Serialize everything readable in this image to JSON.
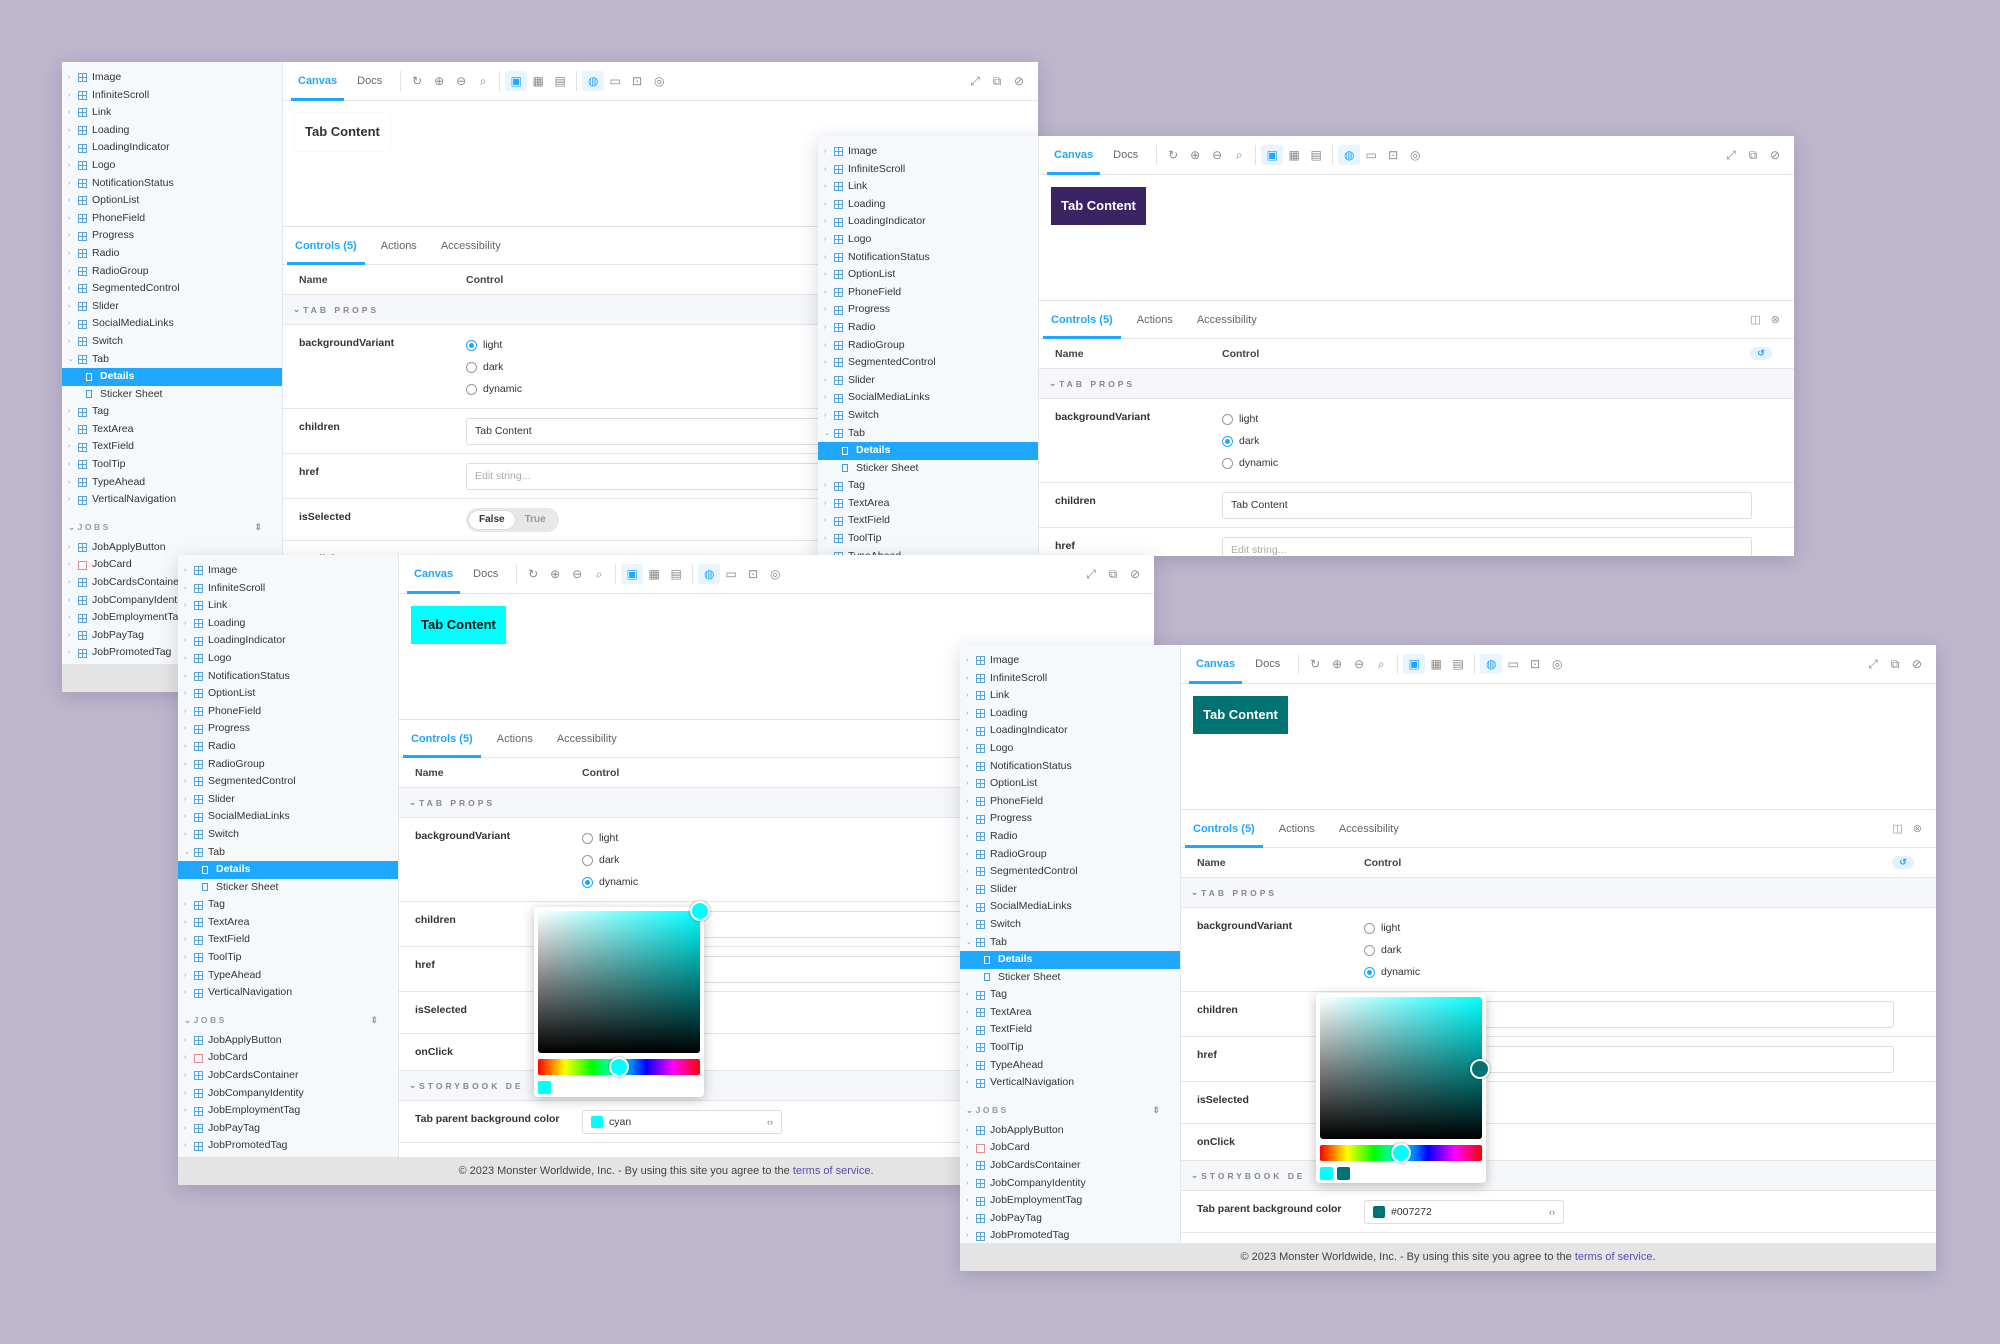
{
  "tree_items": [
    "Image",
    "InfiniteScroll",
    "Link",
    "Loading",
    "LoadingIndicator",
    "Logo",
    "NotificationStatus",
    "OptionList",
    "PhoneField",
    "Progress",
    "Radio",
    "RadioGroup",
    "SegmentedControl",
    "Slider",
    "SocialMediaLinks",
    "Switch",
    "Tab"
  ],
  "tab_stories": [
    "Details",
    "Sticker Sheet"
  ],
  "tree_items_after": [
    "Tag",
    "TextArea",
    "TextField",
    "ToolTip",
    "TypeAhead",
    "VerticalNavigation"
  ],
  "jobs_section": "JOBS",
  "jobs_items": [
    "JobApplyButton",
    "JobCard",
    "JobCardsContainer",
    "JobCompanyIdentity",
    "JobEmploymentTag",
    "JobPayTag",
    "JobPromotedTag"
  ],
  "toolbar": {
    "canvas": "Canvas",
    "docs": "Docs"
  },
  "panel_tabs": {
    "controls": "Controls (5)",
    "actions": "Actions",
    "accessibility": "Accessibility"
  },
  "table": {
    "name_header": "Name",
    "control_header": "Control",
    "group": "TAB PROPS",
    "storybook_group": "STORYBOOK DE"
  },
  "props": {
    "backgroundVariant": "backgroundVariant",
    "options": [
      "light",
      "dark",
      "dynamic"
    ],
    "children": "children",
    "children_value": "Tab Content",
    "href": "href",
    "href_placeholder": "Edit string...",
    "isSelected": "isSelected",
    "false_label": "False",
    "true_label": "True",
    "onClick": "onClick",
    "onClick_value": "-",
    "parent_bg": "Tab parent background color"
  },
  "tab_content": "Tab Content",
  "windows": [
    {
      "selected_variant": "light",
      "tab_bg": "#ffffff",
      "tab_fg": "#333333"
    },
    {
      "selected_variant": "dark",
      "tab_bg": "#3b2463",
      "tab_fg": "#ffffff"
    },
    {
      "selected_variant": "dynamic",
      "tab_bg": "#00ffff",
      "tab_fg": "#111111",
      "parent_color_value": "cyan",
      "parent_color_hex": "#00ffff"
    },
    {
      "selected_variant": "dynamic",
      "tab_bg": "#007272",
      "tab_fg": "#ffffff",
      "parent_color_value": "#007272",
      "parent_color_hex": "#007272"
    }
  ],
  "footer": {
    "text": "© 2023 Monster Worldwide, Inc. - By using this site you agree to the ",
    "link": "terms of service",
    "end": "."
  },
  "colors": {
    "accent": "#1ea7fd",
    "background": "#bdb6cd",
    "dark_tab": "#3b2463",
    "cyan": "#00ffff",
    "teal": "#007272"
  }
}
